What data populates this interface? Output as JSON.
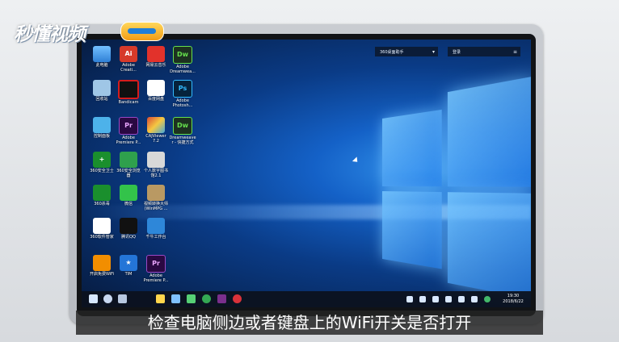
{
  "watermark": {
    "text": "秒懂视频",
    "logo_icon": "watermark-logo-icon"
  },
  "subtitle": {
    "text": "检查电脑侧边或者键盘上的WiFi开关是否打开"
  },
  "desktop": {
    "widgets": {
      "left_label": "360桌面助手",
      "right_label": "登录"
    },
    "icons": [
      {
        "label": "此电脑",
        "glyph": ""
      },
      {
        "label": "回收站",
        "glyph": ""
      },
      {
        "label": "控制面板",
        "glyph": ""
      },
      {
        "label": "360安全卫士",
        "glyph": "+"
      },
      {
        "label": "360杀毒",
        "glyph": ""
      },
      {
        "label": "360软件管家",
        "glyph": ""
      },
      {
        "label": "开启免费WiFi",
        "glyph": ""
      },
      {
        "label": "Adobe\nCreati...",
        "glyph": "Ai"
      },
      {
        "label": "Bandicam",
        "glyph": ""
      },
      {
        "label": "Adobe\nPremiere P...",
        "glyph": "Pr"
      },
      {
        "label": "360安全浏览\n器",
        "glyph": ""
      },
      {
        "label": "微信",
        "glyph": ""
      },
      {
        "label": "腾讯QQ",
        "glyph": ""
      },
      {
        "label": "TIM",
        "glyph": "★"
      },
      {
        "label": "网易云音乐",
        "glyph": ""
      },
      {
        "label": "百度网盘",
        "glyph": ""
      },
      {
        "label": "CAJViewer\n7.2",
        "glyph": ""
      },
      {
        "label": "个人数字图书\n馆2.1",
        "glyph": ""
      },
      {
        "label": "视频转换大师\n(WinMPG ...",
        "glyph": ""
      },
      {
        "label": "千牛工作台",
        "glyph": ""
      },
      {
        "label": "Adobe\nPremiere P...",
        "glyph": "Pr"
      },
      {
        "label": "Adobe\nDreamwea...",
        "glyph": "Dw"
      },
      {
        "label": "Adobe\nPhotosh...",
        "glyph": "Ps"
      },
      {
        "label": "Dreamweave\nr - 快捷方式",
        "glyph": "Dw"
      }
    ]
  },
  "taskbar": {
    "time": "19:30",
    "date": "2018/6/22"
  }
}
